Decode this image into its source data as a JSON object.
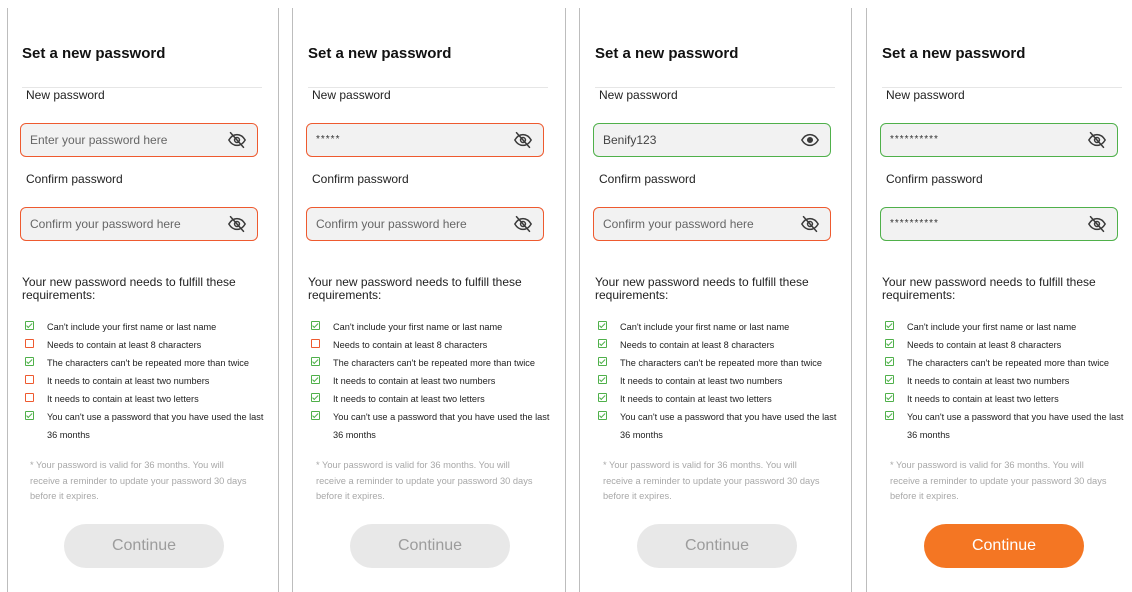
{
  "colors": {
    "error": "#ee5a2f",
    "success": "#4fb04a",
    "accent": "#f47623",
    "disabled_bg": "#e8e8e8"
  },
  "panels": [
    {
      "title": "Set a new password",
      "new_password": {
        "label": "New password",
        "value": "",
        "placeholder": "Enter your password here",
        "valid": false,
        "icon": "eye-off-icon"
      },
      "confirm_password": {
        "label": "Confirm password",
        "value": "",
        "placeholder": "Confirm your password here",
        "valid": false,
        "icon": "eye-off-icon"
      },
      "requirements_title": "Your new password needs to fulfill these requirements:",
      "requirements": [
        {
          "text": "Can't include your first name or last name",
          "met": true
        },
        {
          "text": "Needs to contain at least 8 characters",
          "met": false
        },
        {
          "text": "The characters can't be repeated more than twice",
          "met": true
        },
        {
          "text": "It needs to contain at least two numbers",
          "met": false
        },
        {
          "text": "It needs to contain at least two letters",
          "met": false
        },
        {
          "text": "You can't use a password that you have used the last 36 months",
          "met": true
        }
      ],
      "note": "* Your password is valid for 36 months. You will receive a reminder to update your password 30 days before it expires.",
      "button": {
        "label": "Continue",
        "enabled": false
      }
    },
    {
      "title": "Set a new password",
      "new_password": {
        "label": "New password",
        "value": "*****",
        "placeholder": "",
        "valid": false,
        "icon": "eye-off-icon"
      },
      "confirm_password": {
        "label": "Confirm password",
        "value": "",
        "placeholder": "Confirm your password here",
        "valid": false,
        "icon": "eye-off-icon"
      },
      "requirements_title": "Your new password needs to fulfill these requirements:",
      "requirements": [
        {
          "text": "Can't include your first name or last name",
          "met": true
        },
        {
          "text": "Needs to contain at least 8 characters",
          "met": false
        },
        {
          "text": "The characters can't be repeated more than twice",
          "met": true
        },
        {
          "text": "It needs to contain at least two numbers",
          "met": true
        },
        {
          "text": "It needs to contain at least two letters",
          "met": true
        },
        {
          "text": "You can't use a password that you have used the last 36 months",
          "met": true
        }
      ],
      "note": "* Your password is valid for 36 months. You will receive a reminder to update your password 30 days before it expires.",
      "button": {
        "label": "Continue",
        "enabled": false
      }
    },
    {
      "title": "Set a new password",
      "new_password": {
        "label": "New password",
        "value": "Benify123",
        "placeholder": "",
        "valid": true,
        "icon": "eye-icon"
      },
      "confirm_password": {
        "label": "Confirm password",
        "value": "",
        "placeholder": "Confirm your password here",
        "valid": false,
        "icon": "eye-off-icon"
      },
      "requirements_title": "Your new password needs to fulfill these requirements:",
      "requirements": [
        {
          "text": "Can't include your first name or last name",
          "met": true
        },
        {
          "text": "Needs to contain at least 8 characters",
          "met": true
        },
        {
          "text": "The characters can't be repeated more than twice",
          "met": true
        },
        {
          "text": "It needs to contain at least two numbers",
          "met": true
        },
        {
          "text": "It needs to contain at least two letters",
          "met": true
        },
        {
          "text": "You can't use a password that you have used the last 36 months",
          "met": true
        }
      ],
      "note": "* Your password is valid for 36 months. You will receive a reminder to update your password 30 days before it expires.",
      "button": {
        "label": "Continue",
        "enabled": false
      }
    },
    {
      "title": "Set a new password",
      "new_password": {
        "label": "New password",
        "value": "**********",
        "placeholder": "",
        "valid": true,
        "icon": "eye-off-icon"
      },
      "confirm_password": {
        "label": "Confirm password",
        "value": "**********",
        "placeholder": "",
        "valid": true,
        "icon": "eye-off-icon"
      },
      "requirements_title": "Your new password needs to fulfill these requirements:",
      "requirements": [
        {
          "text": "Can't include your first name or last name",
          "met": true
        },
        {
          "text": "Needs to contain at least 8 characters",
          "met": true
        },
        {
          "text": "The characters can't be repeated more than twice",
          "met": true
        },
        {
          "text": "It needs to contain at least two numbers",
          "met": true
        },
        {
          "text": "It needs to contain at least two letters",
          "met": true
        },
        {
          "text": "You can't use a password that you have used the last 36 months",
          "met": true
        }
      ],
      "note": "* Your password is valid for 36 months. You will receive a reminder to update your password 30 days before it expires.",
      "button": {
        "label": "Continue",
        "enabled": true
      }
    }
  ]
}
